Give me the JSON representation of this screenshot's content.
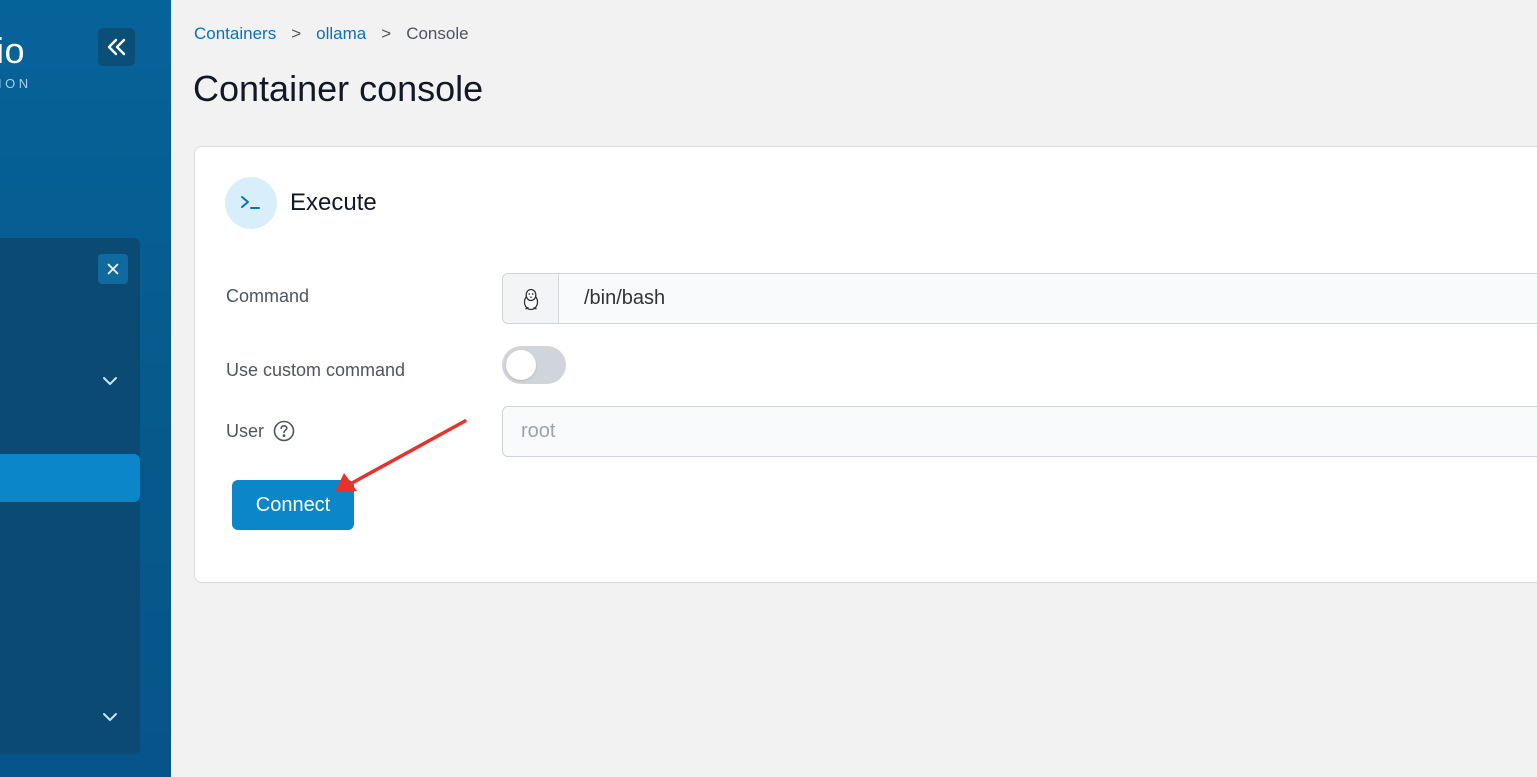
{
  "sidebar": {
    "brand_text": "io",
    "brand_subtext": "ION",
    "collapse_icon": "double-chevron-left-icon",
    "env_close_icon": "close-icon",
    "chevron_icon": "chevron-down-icon"
  },
  "breadcrumb": {
    "items": [
      "Containers",
      "ollama",
      "Console"
    ],
    "separator": ">"
  },
  "page": {
    "title": "Container console"
  },
  "card": {
    "icon": "terminal-icon",
    "title": "Execute"
  },
  "form": {
    "command_label": "Command",
    "command_os_icon": "linux-penguin-icon",
    "command_value": "/bin/bash",
    "custom_command_label": "Use custom command",
    "custom_command_enabled": false,
    "user_label": "User",
    "user_help_icon": "question-circle-icon",
    "user_placeholder": "root",
    "user_value": "",
    "connect_label": "Connect"
  },
  "colors": {
    "sidebar": "#06639a",
    "accent": "#0a86c9",
    "link": "#0b72b5",
    "annotation_arrow": "#e8312b"
  }
}
